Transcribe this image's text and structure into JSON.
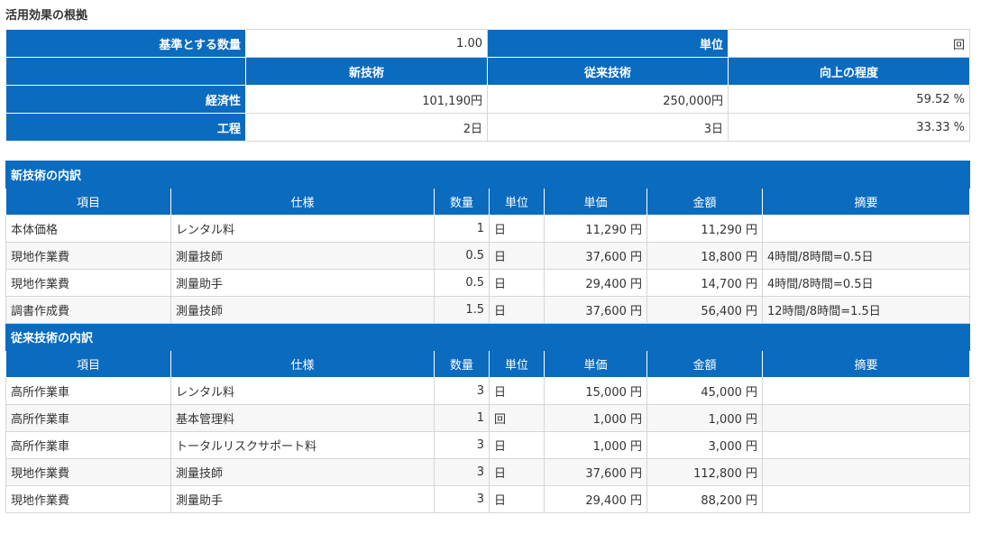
{
  "page_title": "活用効果の根拠",
  "summary": {
    "baseline_label": "基準とする数量",
    "baseline_value": "1.00",
    "unit_label": "単位",
    "unit_value": "回",
    "col_new": "新技術",
    "col_old": "従来技術",
    "col_improve": "向上の程度",
    "rows": [
      {
        "label": "経済性",
        "new": "101,190円",
        "old": "250,000円",
        "improve": "59.52 %"
      },
      {
        "label": "工程",
        "new": "2日",
        "old": "3日",
        "improve": "33.33 %"
      }
    ]
  },
  "columns": [
    "項目",
    "仕様",
    "数量",
    "単位",
    "単価",
    "金額",
    "摘要"
  ],
  "new_tech": {
    "title": "新技術の内訳",
    "rows": [
      {
        "item": "本体価格",
        "spec": "レンタル料",
        "qty": "1",
        "unit": "日",
        "price": "11,290 円",
        "amount": "11,290 円",
        "note": ""
      },
      {
        "item": "現地作業費",
        "spec": "測量技師",
        "qty": "0.5",
        "unit": "日",
        "price": "37,600 円",
        "amount": "18,800 円",
        "note": "4時間/8時間=0.5日"
      },
      {
        "item": "現地作業費",
        "spec": "測量助手",
        "qty": "0.5",
        "unit": "日",
        "price": "29,400 円",
        "amount": "14,700 円",
        "note": "4時間/8時間=0.5日"
      },
      {
        "item": "調書作成費",
        "spec": "測量技師",
        "qty": "1.5",
        "unit": "日",
        "price": "37,600 円",
        "amount": "56,400 円",
        "note": "12時間/8時間=1.5日"
      }
    ]
  },
  "old_tech": {
    "title": "従来技術の内訳",
    "rows": [
      {
        "item": "高所作業車",
        "spec": "レンタル料",
        "qty": "3",
        "unit": "日",
        "price": "15,000 円",
        "amount": "45,000 円",
        "note": ""
      },
      {
        "item": "高所作業車",
        "spec": "基本管理料",
        "qty": "1",
        "unit": "回",
        "price": "1,000 円",
        "amount": "1,000 円",
        "note": ""
      },
      {
        "item": "高所作業車",
        "spec": "トータルリスクサポート料",
        "qty": "3",
        "unit": "日",
        "price": "1,000 円",
        "amount": "3,000 円",
        "note": ""
      },
      {
        "item": "現地作業費",
        "spec": "測量技師",
        "qty": "3",
        "unit": "日",
        "price": "37,600 円",
        "amount": "112,800 円",
        "note": ""
      },
      {
        "item": "現地作業費",
        "spec": "測量助手",
        "qty": "3",
        "unit": "日",
        "price": "29,400 円",
        "amount": "88,200 円",
        "note": ""
      }
    ]
  }
}
